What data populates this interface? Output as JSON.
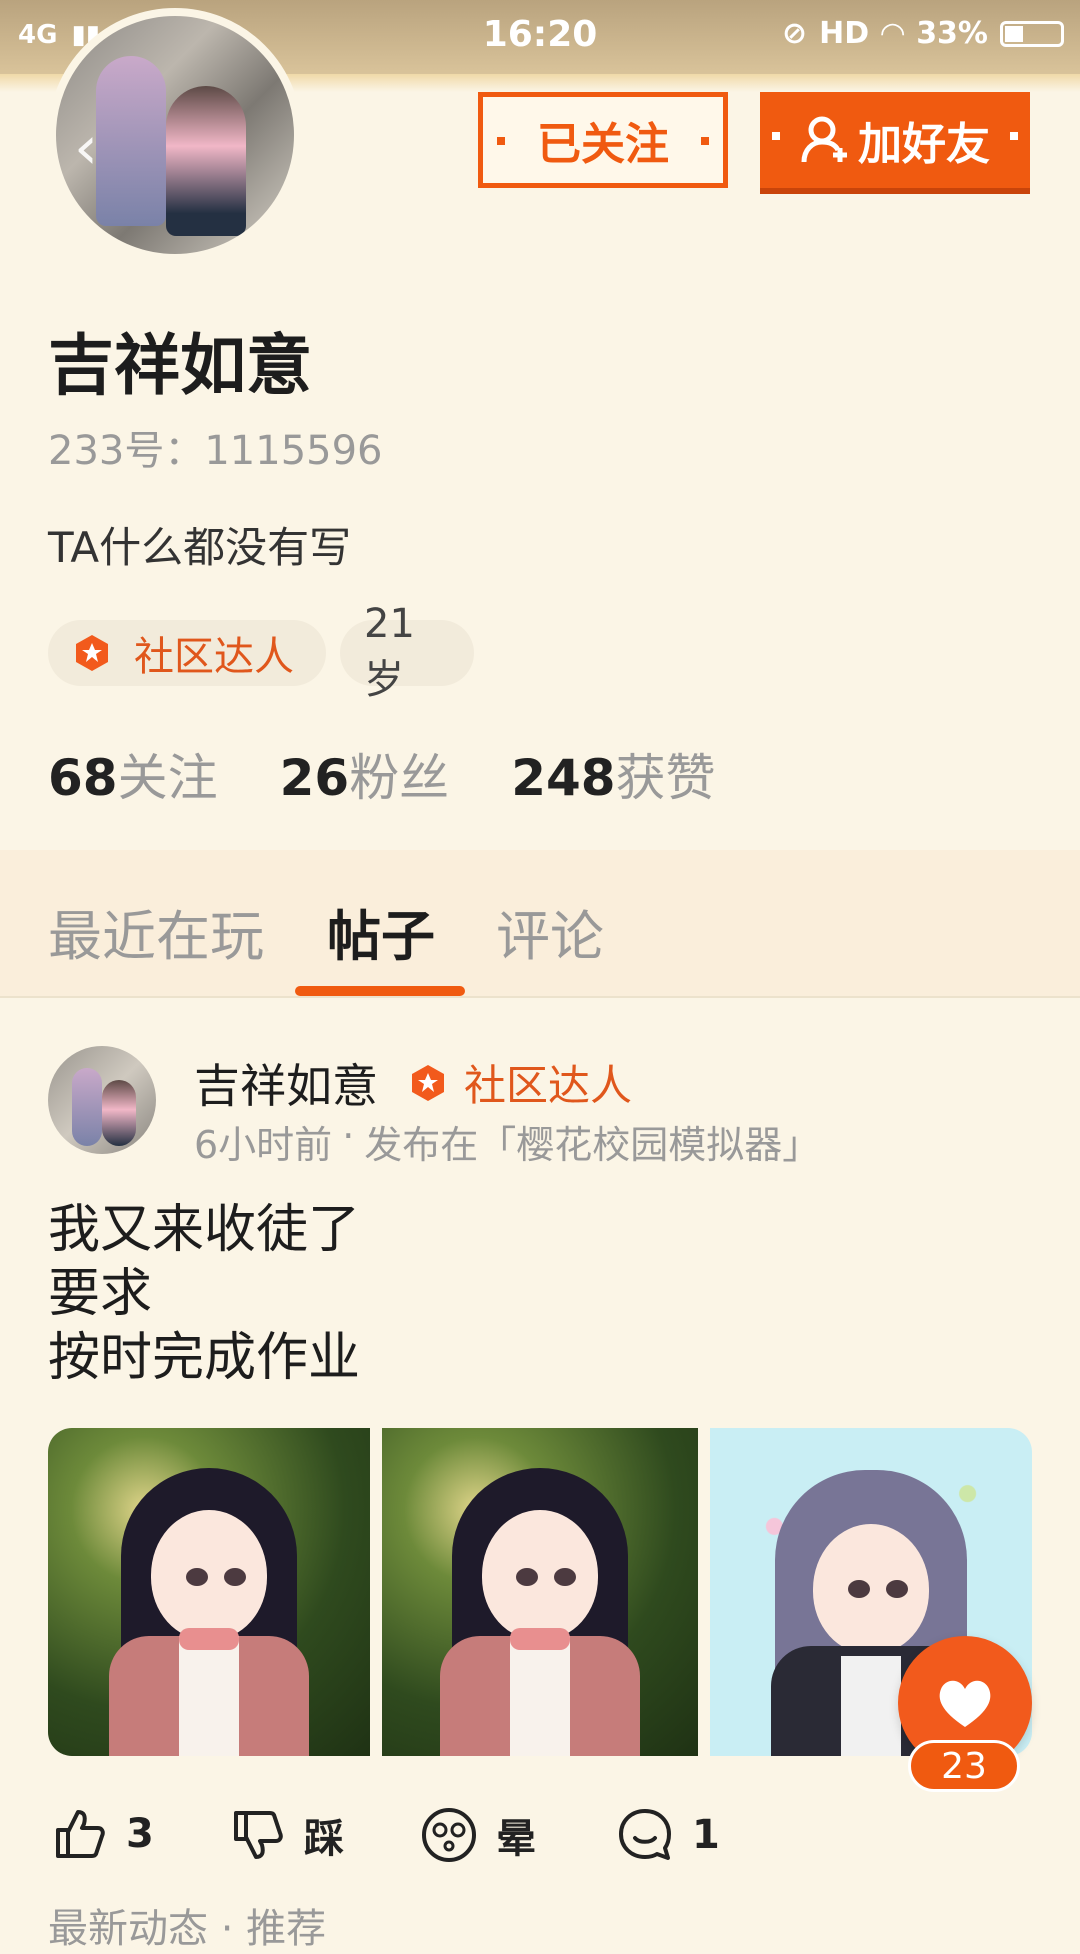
{
  "status_bar": {
    "network": "4G",
    "time": "16:20",
    "hd": "HD",
    "battery": "33%",
    "battery_level": 0.33
  },
  "header": {
    "followed_label": "已关注",
    "add_friend_label": "加好友"
  },
  "profile": {
    "name": "吉祥如意",
    "uid": "233号：1115596",
    "bio": "TA什么都没有写",
    "tags": {
      "expert": "社区达人",
      "age": "21岁"
    },
    "stats": [
      {
        "num": "68",
        "label": "关注"
      },
      {
        "num": "26",
        "label": "粉丝"
      },
      {
        "num": "248",
        "label": "获赞"
      }
    ]
  },
  "tabs": [
    "最近在玩",
    "帖子",
    "评论"
  ],
  "active_tab": "帖子",
  "post": {
    "author": "吉祥如意",
    "badge": "社区达人",
    "time": "6小时前",
    "dot": "·",
    "published_in": "发布在「樱花校园模拟器」",
    "lines": [
      "我又来收徒了",
      "要求",
      "按时完成作业"
    ],
    "like_count": "23",
    "actions": {
      "upvote": "3",
      "downvote": "踩",
      "dizzy": "晕",
      "comment": "1"
    }
  },
  "bottom_peek": "最新动态 · 推荐"
}
